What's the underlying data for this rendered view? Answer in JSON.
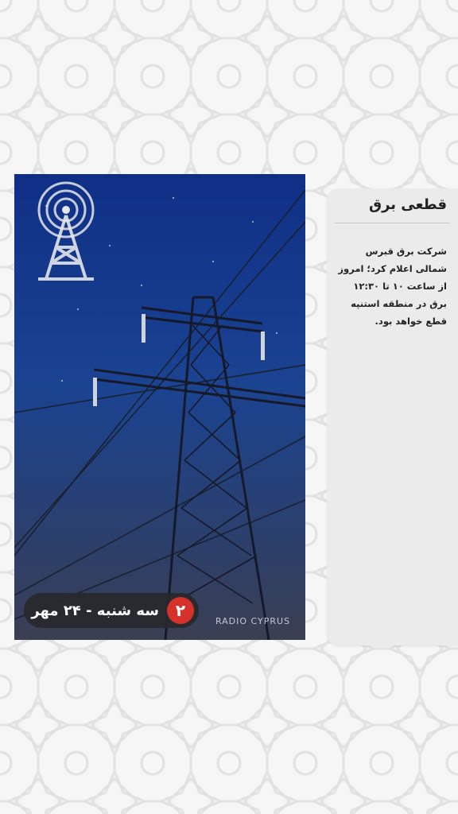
{
  "story": {
    "title": "قطعی برق",
    "body": "شرکت برق قبرس شمالی اعلام کرد؛ امروز از ساعت ۱۰ تا ۱۲:۳۰ برق در منطقه استنپه قطع خواهد بود."
  },
  "photo": {
    "date_label": "سه شنبه - ۲۴ مهر",
    "badge_number": "۲",
    "logo_text": "RADIO CYPRUS"
  },
  "colors": {
    "badge": "#d6312a",
    "sky_top": "#0f2f86",
    "pill": "#28282c"
  },
  "icons": {
    "logo": "radio-tower-icon"
  }
}
